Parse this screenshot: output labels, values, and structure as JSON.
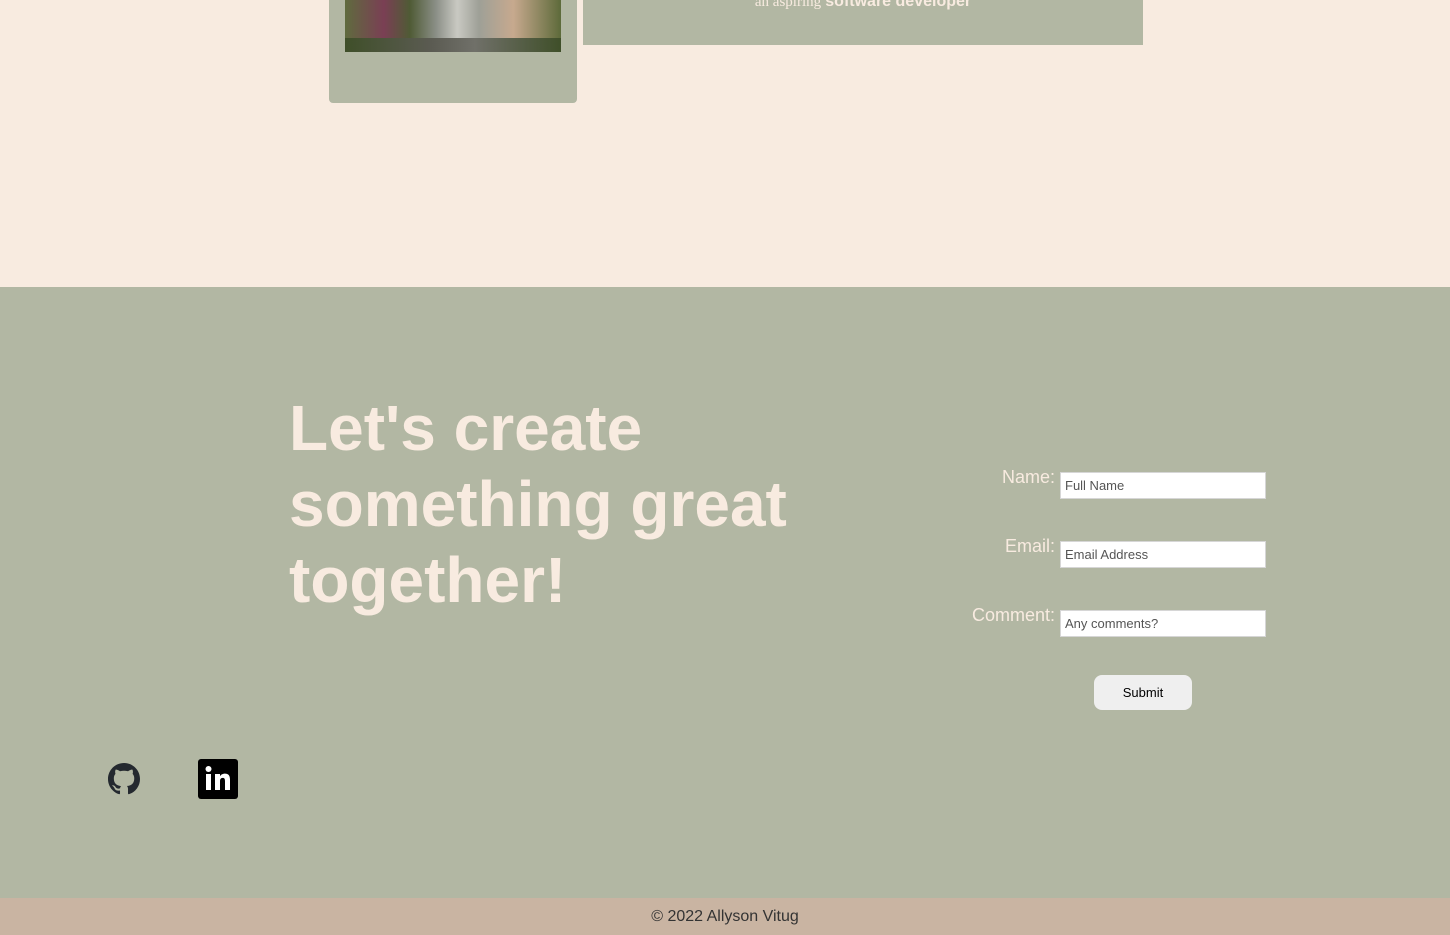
{
  "about": {
    "intro_light": "an aspiring",
    "intro_bold": "software developer"
  },
  "contact": {
    "heading": "Let's create something great together!",
    "form": {
      "name_label": "Name:",
      "name_placeholder": "Full Name",
      "email_label": "Email:",
      "email_placeholder": "Email Address",
      "comment_label": "Comment:",
      "comment_placeholder": "Any comments?",
      "submit_label": "Submit"
    },
    "social": {
      "github_icon": "github-icon",
      "linkedin_icon": "linkedin-icon"
    }
  },
  "footer": {
    "copyright": "© 2022 Allyson Vitug"
  },
  "colors": {
    "cream": "#f8ebe0",
    "sage": "#b2b7a3",
    "tan": "#c9b4a2"
  }
}
